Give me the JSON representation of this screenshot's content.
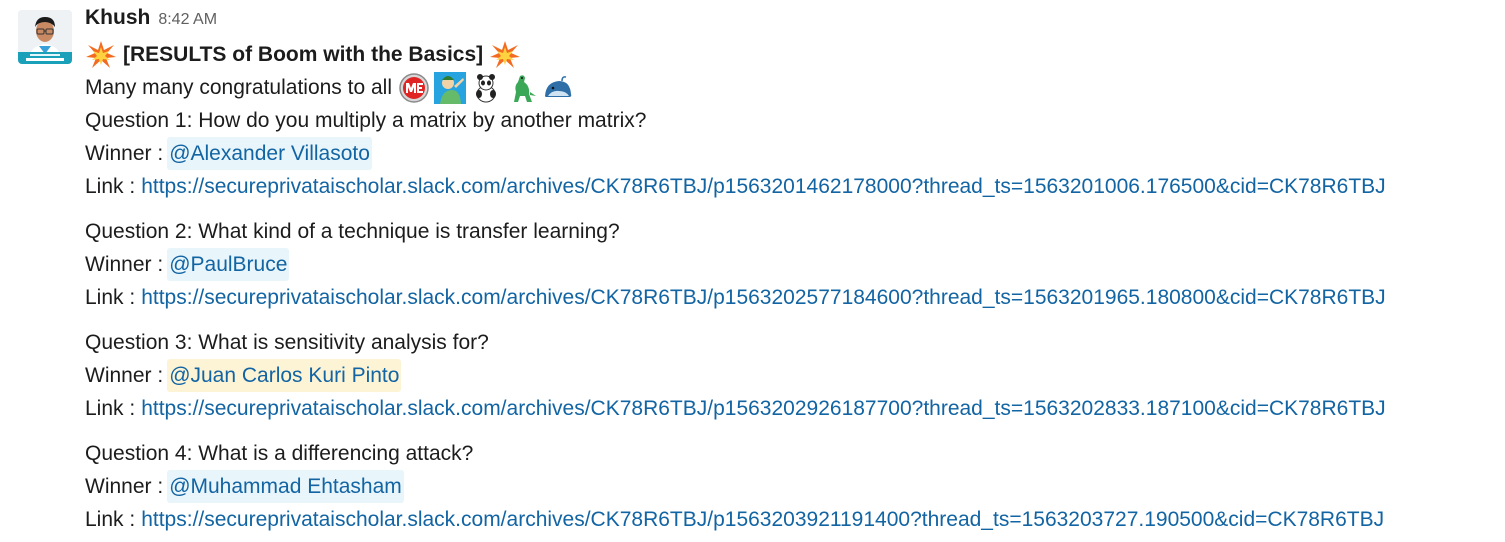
{
  "message": {
    "author": "Khush",
    "time": "8:42 AM",
    "title": "[RESULTS of Boom with the Basics]",
    "intro": "Many many congratulations to all",
    "winner_label": "Winner :",
    "link_label": "Link :",
    "emojis": [
      "boom-icon",
      "me-badge-icon",
      "party-person-icon",
      "panda-icon",
      "dinosaur-icon",
      "whale-icon"
    ],
    "colors": {
      "link": "#1264a3",
      "mention_bg": "#e8f5fa",
      "mention_highlight_bg": "#fdf4d6",
      "text": "#1d1c1d",
      "timestamp": "#616061"
    },
    "questions": [
      {
        "question": "Question 1: How do you multiply a matrix by another matrix?",
        "winner": "@Alexander Villasoto",
        "link": "https://secureprivataischolar.slack.com/archives/CK78R6TBJ/p1563201462178000?thread_ts=1563201006.176500&cid=CK78R6TBJ"
      },
      {
        "question": "Question 2: What kind of a technique is transfer learning?",
        "winner": "@PaulBruce",
        "link": "https://secureprivataischolar.slack.com/archives/CK78R6TBJ/p1563202577184600?thread_ts=1563201965.180800&cid=CK78R6TBJ"
      },
      {
        "question": "Question 3: What is sensitivity analysis for?",
        "winner": "@Juan Carlos Kuri Pinto",
        "link": "https://secureprivataischolar.slack.com/archives/CK78R6TBJ/p1563202926187700?thread_ts=1563202833.187100&cid=CK78R6TBJ"
      },
      {
        "question": "Question 4: What is a differencing attack?",
        "winner": "@Muhammad Ehtasham",
        "link": "https://secureprivataischolar.slack.com/archives/CK78R6TBJ/p1563203921191400?thread_ts=1563203727.190500&cid=CK78R6TBJ"
      }
    ]
  }
}
